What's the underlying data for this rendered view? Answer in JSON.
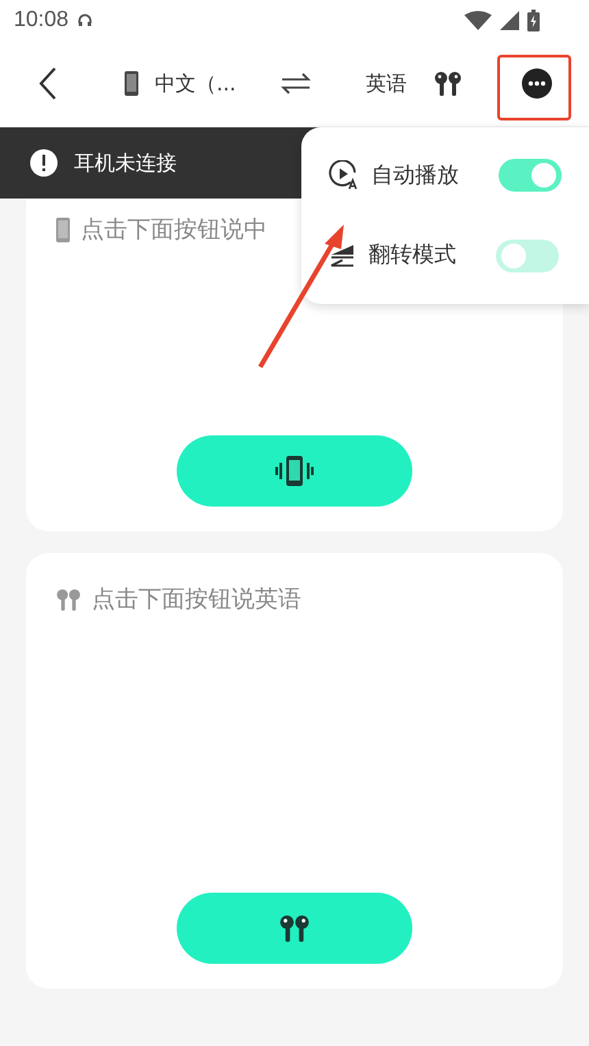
{
  "status_bar": {
    "time": "10:08"
  },
  "top_bar": {
    "source_language": "中文（...",
    "target_language": "英语"
  },
  "toast": {
    "message": "耳机未连接"
  },
  "cards": [
    {
      "kind": "phone",
      "prompt": "点击下面按钮说中"
    },
    {
      "kind": "earbuds",
      "prompt": "点击下面按钮说英语"
    }
  ],
  "menu": {
    "items": [
      {
        "kind": "autoplay",
        "label": "自动播放",
        "on": true
      },
      {
        "kind": "flip",
        "label": "翻转模式",
        "on": false
      }
    ]
  }
}
